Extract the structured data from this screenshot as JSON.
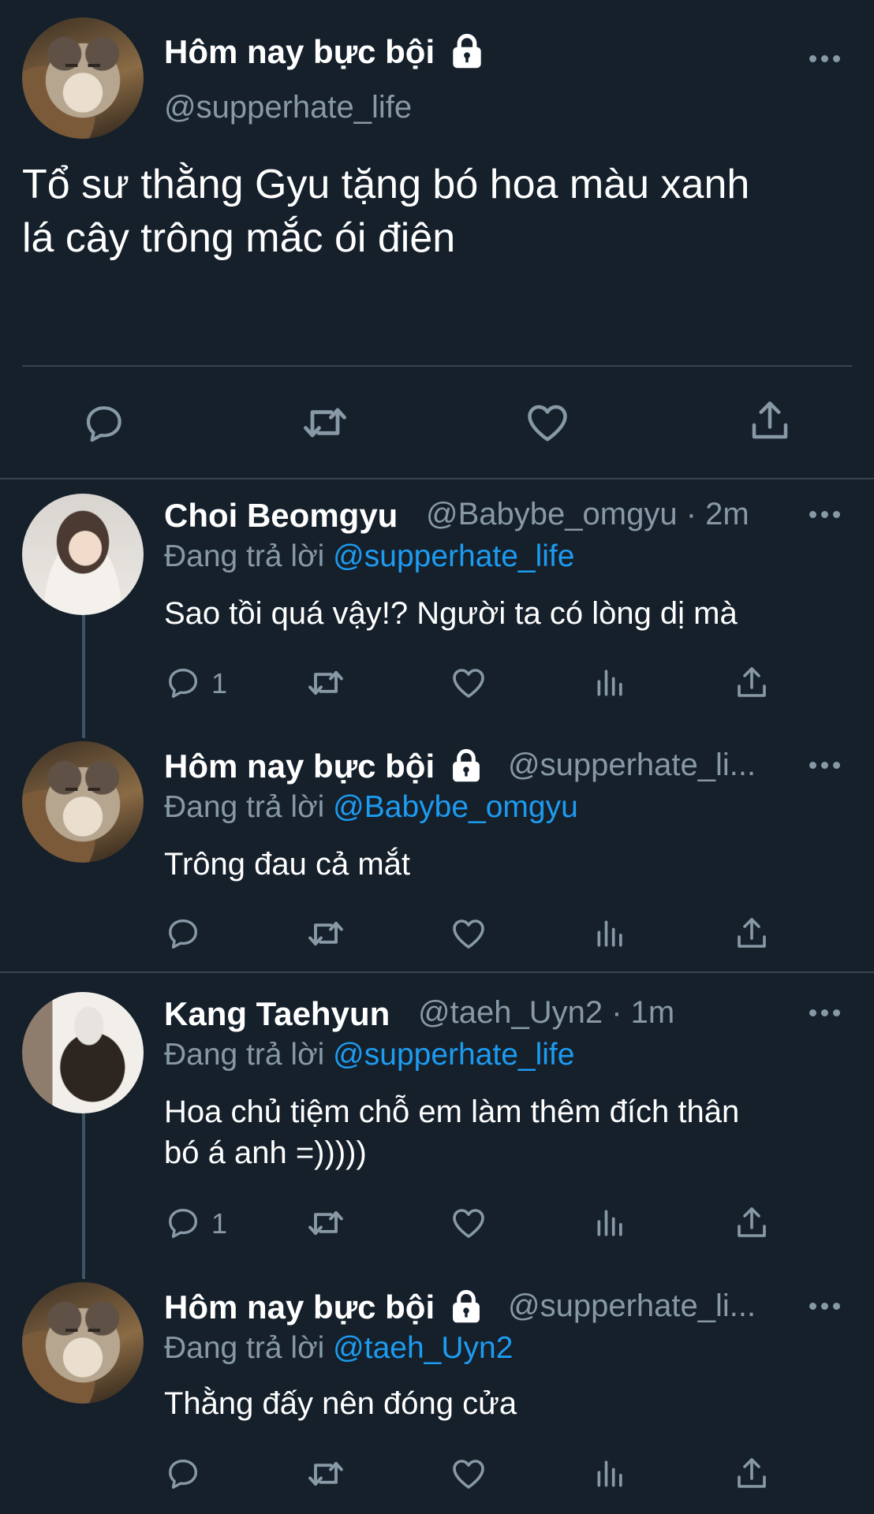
{
  "main_tweet": {
    "display_name": "Hôm nay bực bội",
    "handle": "@supperhate_life",
    "text_line1": "Tổ sư thằng Gyu tặng bó hoa màu xanh",
    "text_line2": "lá cây trông mắc ói điên",
    "icons": [
      "lock-icon",
      "more-icon",
      "reply-icon",
      "retweet-icon",
      "like-icon",
      "share-icon"
    ]
  },
  "replies": [
    {
      "display_name": "Choi Beomgyu",
      "meta": "@Babybe_omgyu · 2m",
      "replying_prefix": "Đang trả lời ",
      "replying_to": "@supperhate_life",
      "text": "Sao tồi quá vậy!? Người ta có lòng dị mà",
      "reply_count": "1"
    },
    {
      "display_name": "Hôm nay bực bội",
      "meta": "@supperhate_li...",
      "replying_prefix": "Đang trả lời ",
      "replying_to": "@Babybe_omgyu",
      "text": "Trông đau cả mắt"
    },
    {
      "display_name": "Kang Taehyun",
      "meta": "@taeh_Uyn2 · 1m",
      "replying_prefix": "Đang trả lời ",
      "replying_to": "@supperhate_life",
      "text_line1": "Hoa chủ tiệm chỗ em làm thêm đích thân",
      "text_line2": "bó á anh =)))))",
      "reply_count": "1"
    },
    {
      "display_name": "Hôm nay bực bội",
      "meta": "@supperhate_li...",
      "replying_prefix": "Đang trả lời ",
      "replying_to": "@taeh_Uyn2",
      "text": "Thằng đấy nên đóng cửa"
    }
  ],
  "colors": {
    "background": "#15202b",
    "secondary_text": "#8899a6",
    "mention": "#1d9bf0",
    "divider": "#38444d"
  }
}
